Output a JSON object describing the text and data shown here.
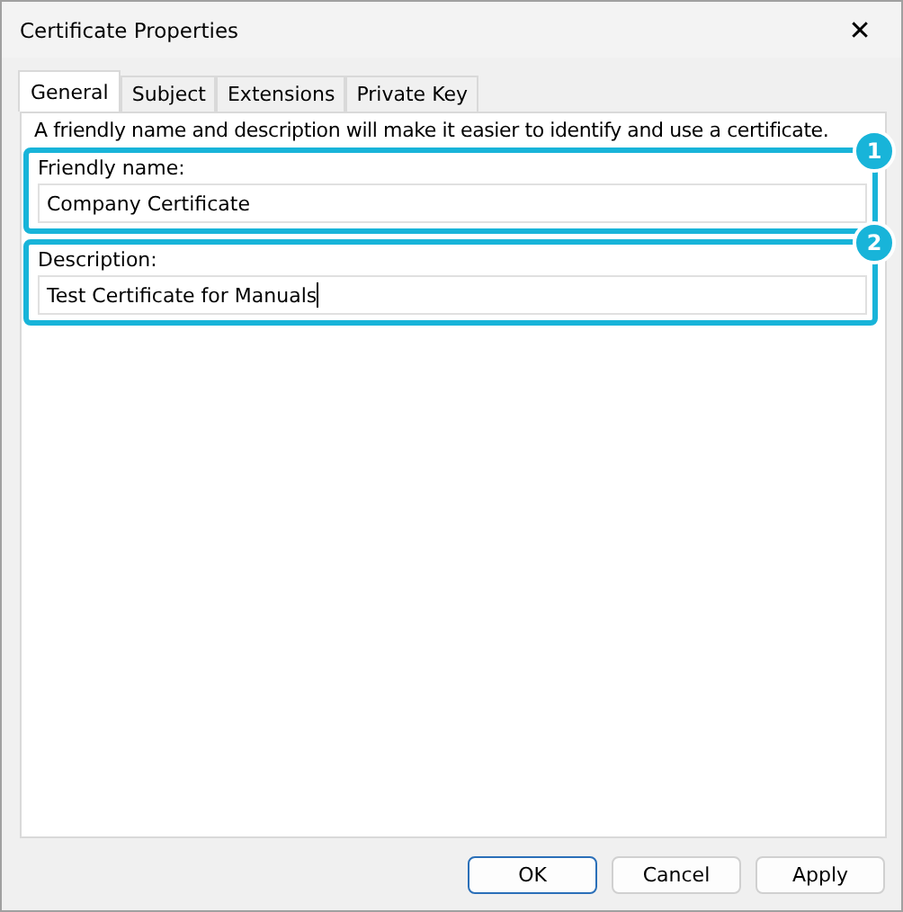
{
  "window": {
    "title": "Certificate Properties",
    "close_glyph": "✕"
  },
  "tabs": [
    {
      "label": "General",
      "selected": true
    },
    {
      "label": "Subject",
      "selected": false
    },
    {
      "label": "Extensions",
      "selected": false
    },
    {
      "label": "Private Key",
      "selected": false
    }
  ],
  "intro": "A friendly name and description will make it easier to identify and use a certificate.",
  "fields": [
    {
      "label": "Friendly name:",
      "value": "Company Certificate",
      "focused": false,
      "callout": "1"
    },
    {
      "label": "Description:",
      "value": "Test Certificate for Manuals",
      "focused": true,
      "callout": "2"
    }
  ],
  "buttons": [
    {
      "label": "OK",
      "default": true
    },
    {
      "label": "Cancel",
      "default": false
    },
    {
      "label": "Apply",
      "default": false
    }
  ]
}
